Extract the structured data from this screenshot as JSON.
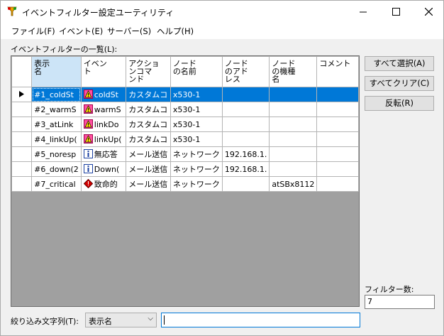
{
  "window": {
    "title": "イベントフィルター設定ユーティリティ"
  },
  "menu": [
    "ファイル(F)",
    "イベント(E)",
    "サーバー(S)",
    "ヘルプ(H)"
  ],
  "list_label": "イベントフィルターの一覧(L):",
  "columns": [
    {
      "lines": [
        "表示",
        "名"
      ]
    },
    {
      "lines": [
        "イベン",
        "ト"
      ]
    },
    {
      "lines": [
        "アクショ",
        "ンコマ",
        "ンド"
      ]
    },
    {
      "lines": [
        "ノード",
        "の名前"
      ]
    },
    {
      "lines": [
        "ノード",
        "のアド",
        "レス"
      ]
    },
    {
      "lines": [
        "ノード",
        "の機種",
        "名"
      ]
    },
    {
      "lines": [
        "コメント"
      ]
    }
  ],
  "rows": [
    {
      "name": "#1_coldSt",
      "event_icon": "warning-icon",
      "event": "coldSt",
      "action": "カスタムコ",
      "node": "x530-1",
      "address": "",
      "model": "",
      "comment": "",
      "selected": true
    },
    {
      "name": "#2_warmS",
      "event_icon": "warning-icon",
      "event": "warmS",
      "action": "カスタムコ",
      "node": "x530-1",
      "address": "",
      "model": "",
      "comment": ""
    },
    {
      "name": "#3_atLink",
      "event_icon": "warning-icon",
      "event": "linkDo",
      "action": "カスタムコ",
      "node": "x530-1",
      "address": "",
      "model": "",
      "comment": ""
    },
    {
      "name": "#4_linkUp(",
      "event_icon": "warning-icon",
      "event": "linkUp(",
      "action": "カスタムコ",
      "node": "x530-1",
      "address": "",
      "model": "",
      "comment": ""
    },
    {
      "name": "#5_noresp",
      "event_icon": "info-icon",
      "event": "無応答",
      "action": "メール送信",
      "node": "ネットワーク",
      "address": "192.168.1.",
      "model": "",
      "comment": ""
    },
    {
      "name": "#6_down(2",
      "event_icon": "info-icon",
      "event": "Down(",
      "action": "メール送信",
      "node": "ネットワーク",
      "address": "192.168.1.",
      "model": "",
      "comment": ""
    },
    {
      "name": "#7_critical",
      "event_icon": "critical-icon",
      "event": "致命的",
      "action": "メール送信",
      "node": "ネットワーク",
      "address": "",
      "model": "atSBx8112",
      "comment": ""
    }
  ],
  "buttons": {
    "select_all": "すべて選択(A)",
    "clear_all": "すべてクリア(C)",
    "invert": "反転(R)"
  },
  "filter_count": {
    "label": "フィルター数:",
    "value": "7"
  },
  "filter": {
    "label": "絞り込み文字列(T):",
    "field": "表示名",
    "text": ""
  },
  "colors": {
    "selection": "#0078d7",
    "sorted_header": "#cce4f7",
    "grid_empty": "#a0a0a0"
  }
}
